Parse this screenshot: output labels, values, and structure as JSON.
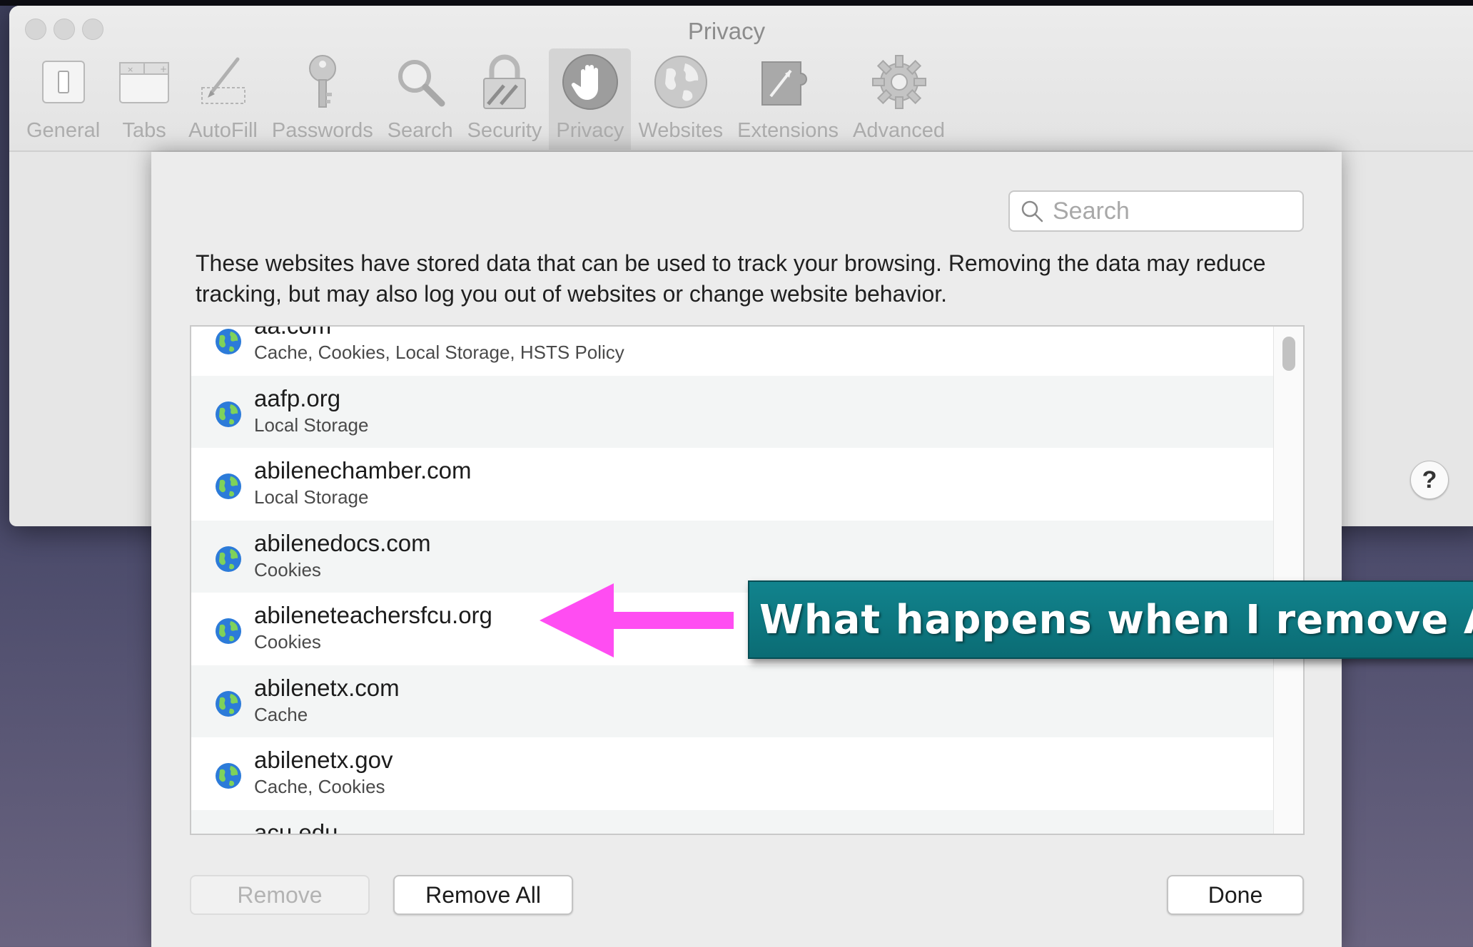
{
  "window": {
    "title": "Privacy"
  },
  "toolbar": {
    "items": [
      {
        "label": "General",
        "icon": "general-icon",
        "active": false
      },
      {
        "label": "Tabs",
        "icon": "tabs-icon",
        "active": false
      },
      {
        "label": "AutoFill",
        "icon": "autofill-icon",
        "active": false
      },
      {
        "label": "Passwords",
        "icon": "key-icon",
        "active": false
      },
      {
        "label": "Search",
        "icon": "magnifier-icon",
        "active": false
      },
      {
        "label": "Security",
        "icon": "lock-icon",
        "active": false
      },
      {
        "label": "Privacy",
        "icon": "hand-icon",
        "active": true
      },
      {
        "label": "Websites",
        "icon": "globe-icon",
        "active": false
      },
      {
        "label": "Extensions",
        "icon": "puzzle-icon",
        "active": false
      },
      {
        "label": "Advanced",
        "icon": "gear-icon",
        "active": false
      }
    ]
  },
  "help": {
    "label": "?"
  },
  "sheet": {
    "search_placeholder": "Search",
    "description": "These websites have stored data that can be used to track your browsing. Removing the data may reduce tracking, but may also log you out of websites or change website behavior.",
    "websites": [
      {
        "domain": "aa.com",
        "data": "Cache, Cookies, Local Storage, HSTS Policy"
      },
      {
        "domain": "aafp.org",
        "data": "Local Storage"
      },
      {
        "domain": "abilenechamber.com",
        "data": "Local Storage"
      },
      {
        "domain": "abilenedocs.com",
        "data": "Cookies"
      },
      {
        "domain": "abileneteachersfcu.org",
        "data": "Cookies"
      },
      {
        "domain": "abilenetx.com",
        "data": "Cache"
      },
      {
        "domain": "abilenetx.gov",
        "data": "Cache, Cookies"
      },
      {
        "domain": "acu.edu",
        "data": ""
      }
    ],
    "buttons": {
      "remove": "Remove",
      "remove_all": "Remove All",
      "done": "Done"
    }
  },
  "annotation": {
    "callout_text": "What happens when I remove All",
    "arrow_color": "#ff4df2",
    "callout_color": "#0e7a83"
  }
}
